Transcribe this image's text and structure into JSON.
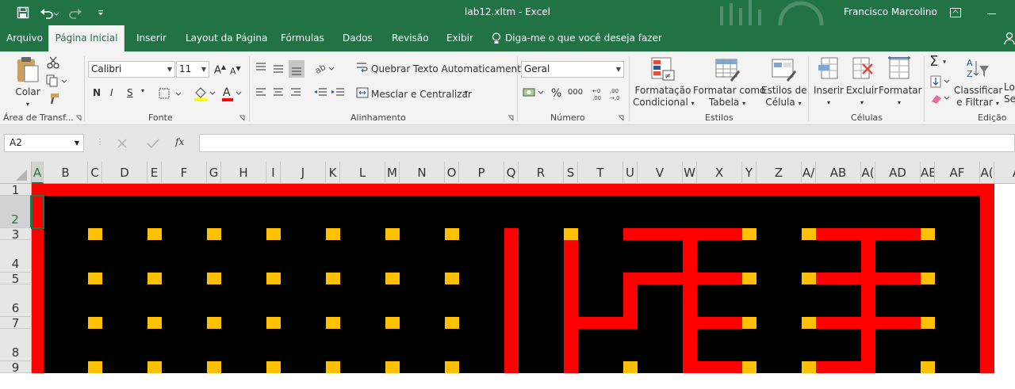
{
  "window": {
    "title": "lab12.xltm  -  Excel",
    "user": "Francisco Marcolino"
  },
  "tabs": [
    {
      "label": "Arquivo",
      "active": false
    },
    {
      "label": "Página Inicial",
      "active": true
    },
    {
      "label": "Inserir",
      "active": false
    },
    {
      "label": "Layout da Página",
      "active": false
    },
    {
      "label": "Fórmulas",
      "active": false
    },
    {
      "label": "Dados",
      "active": false
    },
    {
      "label": "Revisão",
      "active": false
    },
    {
      "label": "Exibir",
      "active": false
    }
  ],
  "tellme": "Diga-me o que você deseja fazer",
  "ribbon": {
    "clipboard": {
      "paste": "Colar",
      "label": "Área de Transf..."
    },
    "font": {
      "name": "Calibri",
      "size": "11",
      "bold": "N",
      "italic": "I",
      "underline": "S",
      "label": "Fonte"
    },
    "alignment": {
      "wrap": "Quebrar Texto Automaticamente",
      "merge": "Mesclar e Centralizar",
      "label": "Alinhamento"
    },
    "number": {
      "format": "Geral",
      "percent": "%",
      "thousands": "000",
      "label": "Número"
    },
    "styles": {
      "conditional": [
        "Formatação",
        "Condicional"
      ],
      "table": [
        "Formatar como",
        "Tabela"
      ],
      "cell": [
        "Estilos de",
        "Célula"
      ],
      "label": "Estilos"
    },
    "cells": {
      "insert": "Inserir",
      "delete": "Excluir",
      "format": "Formatar",
      "label": "Células"
    },
    "editing": {
      "sort": [
        "Classificar",
        "e Filtrar"
      ],
      "find": [
        "Lo",
        "Sel"
      ],
      "label": "Edição"
    }
  },
  "formula_bar": {
    "name_box": "A2",
    "fx": "fx"
  },
  "columns": [
    "A",
    "B",
    "C",
    "D",
    "E",
    "F",
    "G",
    "H",
    "I",
    "J",
    "K",
    "L",
    "M",
    "N",
    "O",
    "P",
    "Q",
    "R",
    "S",
    "T",
    "U",
    "V",
    "W",
    "X",
    "Y",
    "Z",
    "AA",
    "AB",
    "AC",
    "AD",
    "AE",
    "AF",
    "AG",
    "AH"
  ],
  "column_headers": [
    "A",
    "B",
    "C",
    "D",
    "E",
    "F",
    "G",
    "H",
    "I",
    "J",
    "K",
    "L",
    "M",
    "N",
    "O",
    "P",
    "Q",
    "R",
    "S",
    "T",
    "U",
    "V",
    "W",
    "X",
    "Y",
    "Z",
    "A/",
    "AB",
    "A(",
    "AD",
    "AE",
    "AF",
    "A(",
    "A"
  ],
  "rows": [
    "1",
    "2",
    "3",
    "4",
    "5",
    "6",
    "7",
    "8",
    "9"
  ],
  "selected_cell": "A2",
  "colors": {
    "accent": "#217346",
    "wall": "#ff0000",
    "floor": "#000000",
    "dot": "#ffc000"
  }
}
